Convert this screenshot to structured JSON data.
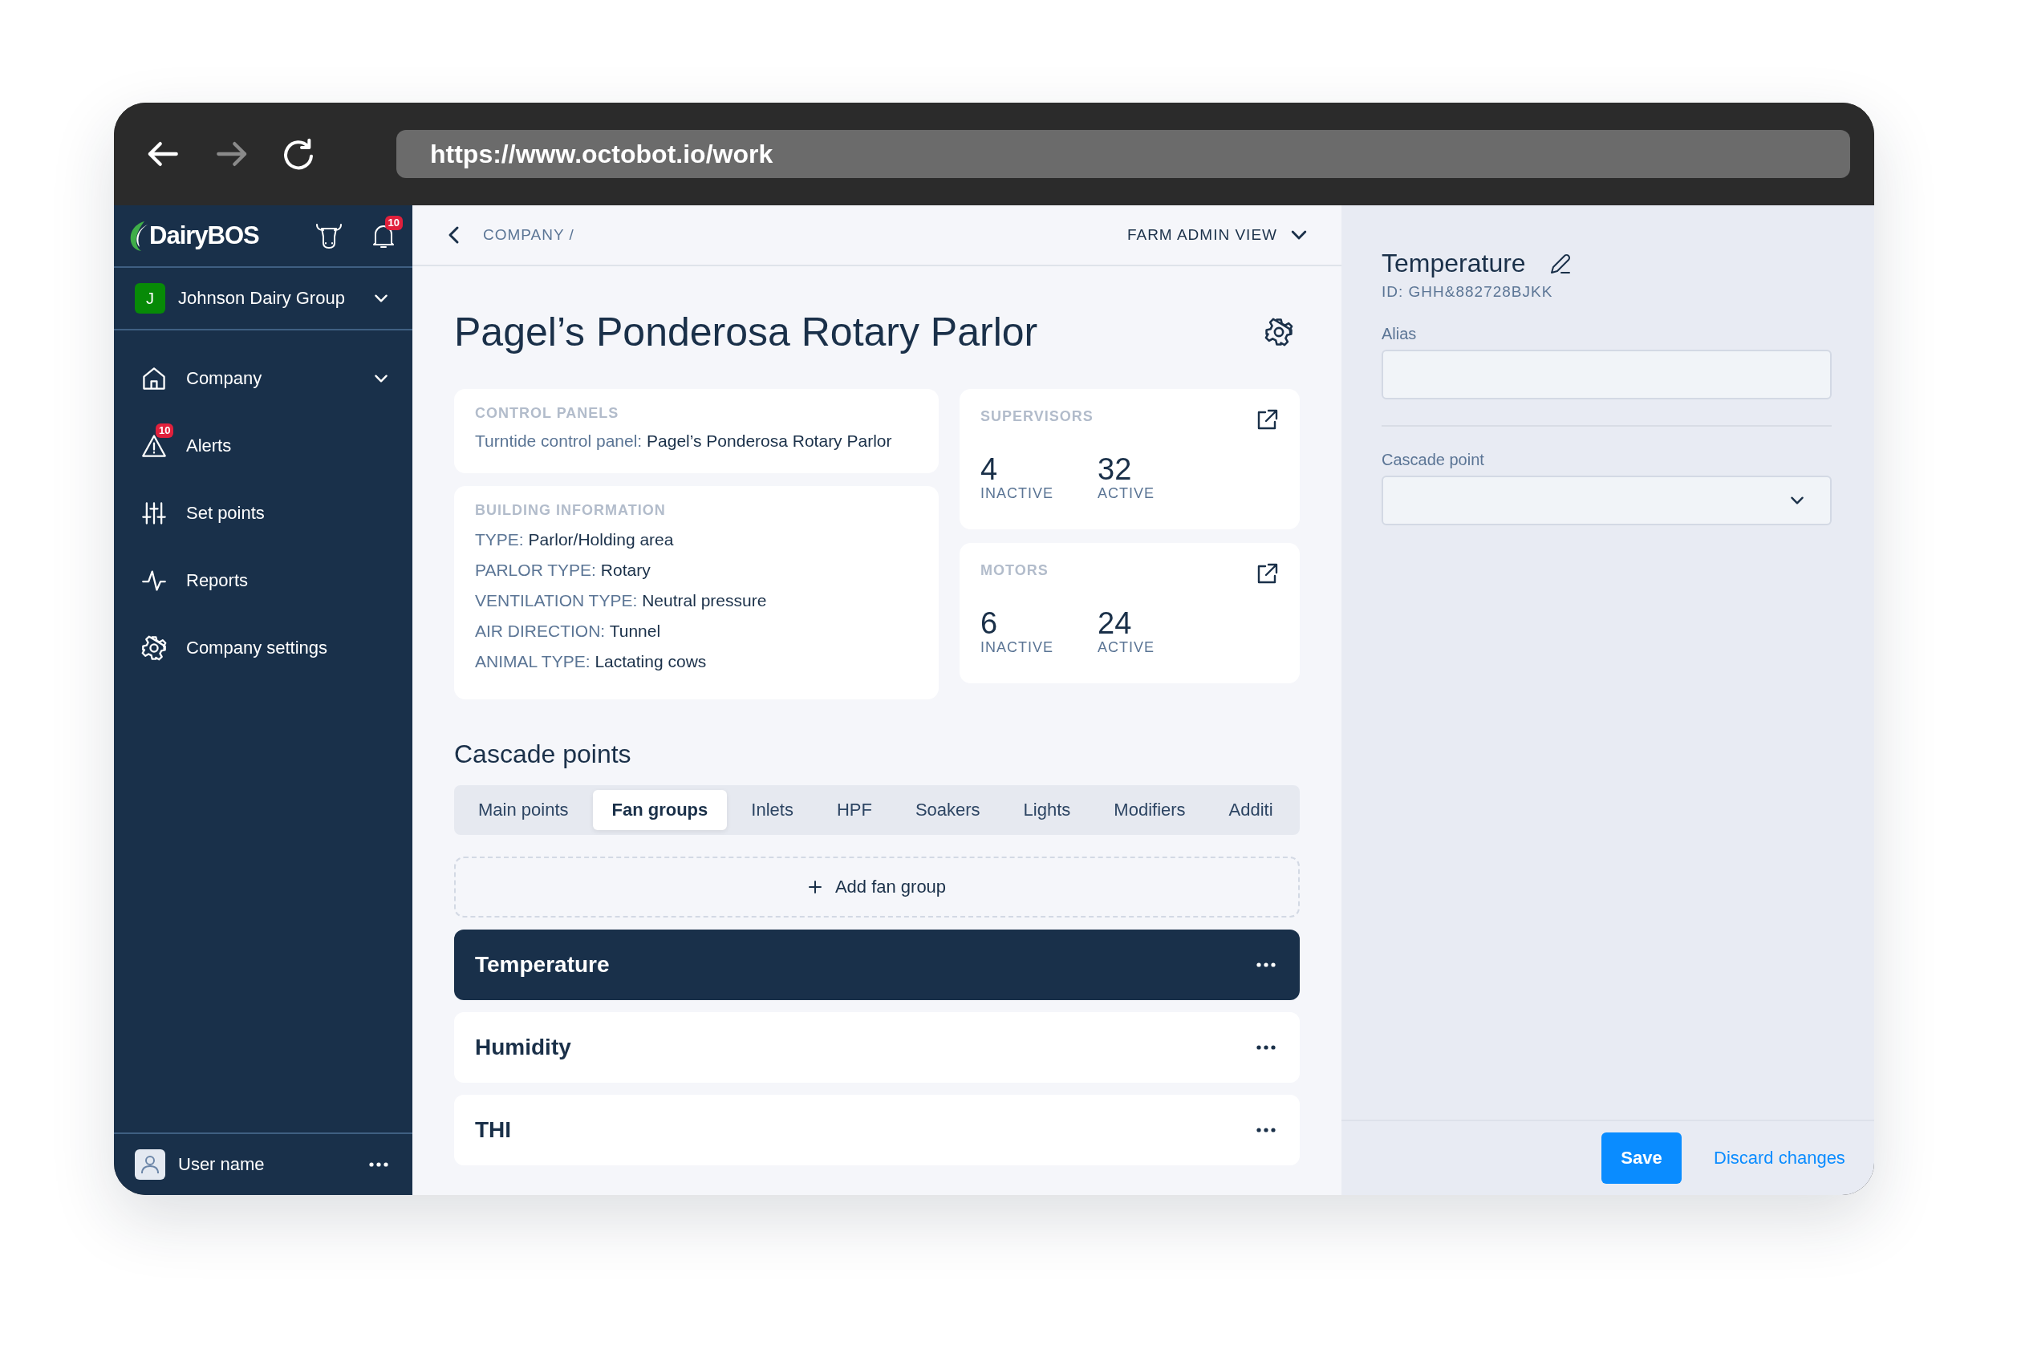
{
  "browser": {
    "url": "https://www.octobot.io/work",
    "nav_buttons": [
      {
        "kind": "back",
        "disabled": false
      },
      {
        "kind": "forward",
        "disabled": true
      },
      {
        "kind": "reload",
        "disabled": false
      }
    ]
  },
  "sidebar": {
    "logo": "DairyBOS",
    "notification_badge": "10",
    "organization": {
      "initial": "J",
      "name": "Johnson Dairy Group"
    },
    "items": [
      {
        "kind": "home",
        "label": "Company",
        "submenu": true
      },
      {
        "kind": "alert",
        "label": "Alerts",
        "submenu": false,
        "badge": "10"
      },
      {
        "kind": "sliders",
        "label": "Set points",
        "submenu": false
      },
      {
        "kind": "pulse",
        "label": "Reports",
        "submenu": false
      },
      {
        "kind": "gear",
        "label": "Company settings",
        "submenu": false
      }
    ],
    "user": {
      "name": "User name"
    }
  },
  "main": {
    "breadcrumb": "COMPANY /",
    "view_menu": "FARM ADMIN VIEW",
    "title": "Pagel’s Ponderosa Rotary Parlor",
    "control_panels": {
      "heading": "CONTROL PANELS",
      "label": "Turntide control panel:",
      "value": "Pagel’s Ponderosa Rotary Parlor"
    },
    "building": {
      "heading": "BUILDING INFORMATION",
      "fields": [
        {
          "label": "TYPE:",
          "value": "Parlor/Holding area"
        },
        {
          "label": "PARLOR TYPE:",
          "value": "Rotary"
        },
        {
          "label": "VENTILATION TYPE:",
          "value": "Neutral pressure"
        },
        {
          "label": "AIR DIRECTION:",
          "value": "Tunnel"
        },
        {
          "label": "ANIMAL TYPE:",
          "value": "Lactating cows"
        }
      ]
    },
    "stat_cards": [
      {
        "heading": "SUPERVISORS",
        "stats": [
          {
            "value": "4",
            "label": "INACTIVE"
          },
          {
            "value": "32",
            "label": "ACTIVE"
          }
        ]
      },
      {
        "heading": "MOTORS",
        "stats": [
          {
            "value": "6",
            "label": "INACTIVE"
          },
          {
            "value": "24",
            "label": "ACTIVE"
          }
        ]
      }
    ],
    "cascade": {
      "heading": "Cascade points",
      "tabs": [
        {
          "label": "Main points",
          "selected": false
        },
        {
          "label": "Fan groups",
          "selected": true
        },
        {
          "label": "Inlets",
          "selected": false
        },
        {
          "label": "HPF",
          "selected": false
        },
        {
          "label": "Soakers",
          "selected": false
        },
        {
          "label": "Lights",
          "selected": false
        },
        {
          "label": "Modifiers",
          "selected": false
        },
        {
          "label": "Additi",
          "selected": false
        }
      ],
      "add_button": "Add fan group",
      "groups": [
        {
          "name": "Temperature",
          "selected": true
        },
        {
          "name": "Humidity",
          "selected": false
        },
        {
          "name": "THI",
          "selected": false
        }
      ]
    }
  },
  "panel": {
    "title": "Temperature",
    "id": "ID: GHH&882728BJKK",
    "fields": [
      {
        "kind": "text",
        "label": "Alias"
      },
      {
        "kind": "select",
        "label": "Cascade point"
      }
    ],
    "save": "Save",
    "discard": "Discard changes"
  }
}
